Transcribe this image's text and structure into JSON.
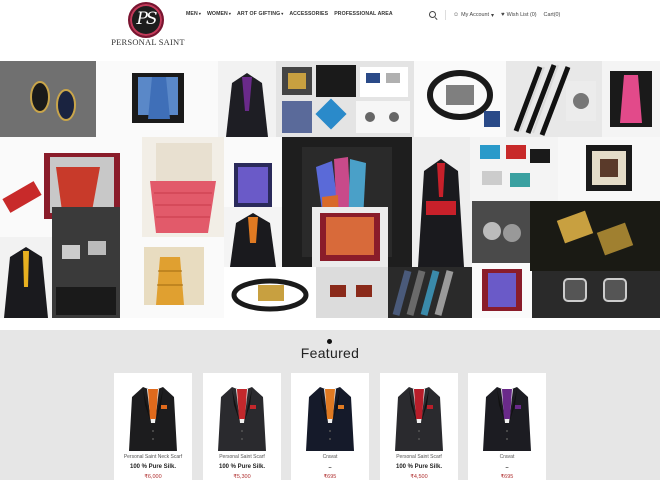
{
  "brand": {
    "monogram": "PS",
    "name": "PERSONAL SAINT"
  },
  "nav": [
    {
      "label": "MEN",
      "caret": true
    },
    {
      "label": "WOMEN",
      "caret": true
    },
    {
      "label": "ART OF GIFTING",
      "caret": true
    },
    {
      "label": "ACCESSORIES",
      "caret": false
    },
    {
      "label": "PROFESSIONAL AREA",
      "caret": false
    }
  ],
  "header_right": {
    "account": "My Account",
    "wishlist": "Wish List (0)",
    "cart": "Cart(0)"
  },
  "featured": {
    "title": "Featured",
    "products": [
      {
        "name": "Personal Saint Neck Scarf",
        "desc": "100 % Pure Silk.",
        "price": "₹6,000",
        "suit": "#1c1c1e",
        "accent": "#e06a1c"
      },
      {
        "name": "Personal Saint Scarf",
        "desc": "100 % Pure Silk.",
        "price": "₹5,300",
        "suit": "#2a2a2e",
        "accent": "#c2282c"
      },
      {
        "name": "Cravat",
        "desc": "..",
        "price": "₹695",
        "suit": "#151a2a",
        "accent": "#e07a22"
      },
      {
        "name": "Personal Saint Scarf",
        "desc": "100 % Pure Silk.",
        "price": "₹4,500",
        "suit": "#2a2a2e",
        "accent": "#b81e2a"
      },
      {
        "name": "Cravat",
        "desc": "..",
        "price": "₹695",
        "suit": "#1c1c22",
        "accent": "#6a2a8a"
      }
    ]
  },
  "colors": {
    "price": "#b03030",
    "featured_bg": "#e6e6e6",
    "logo_ring": "#7a1430"
  },
  "icons": [
    "search-icon",
    "user-icon",
    "heart-icon",
    "dropdown-caret-icon"
  ]
}
